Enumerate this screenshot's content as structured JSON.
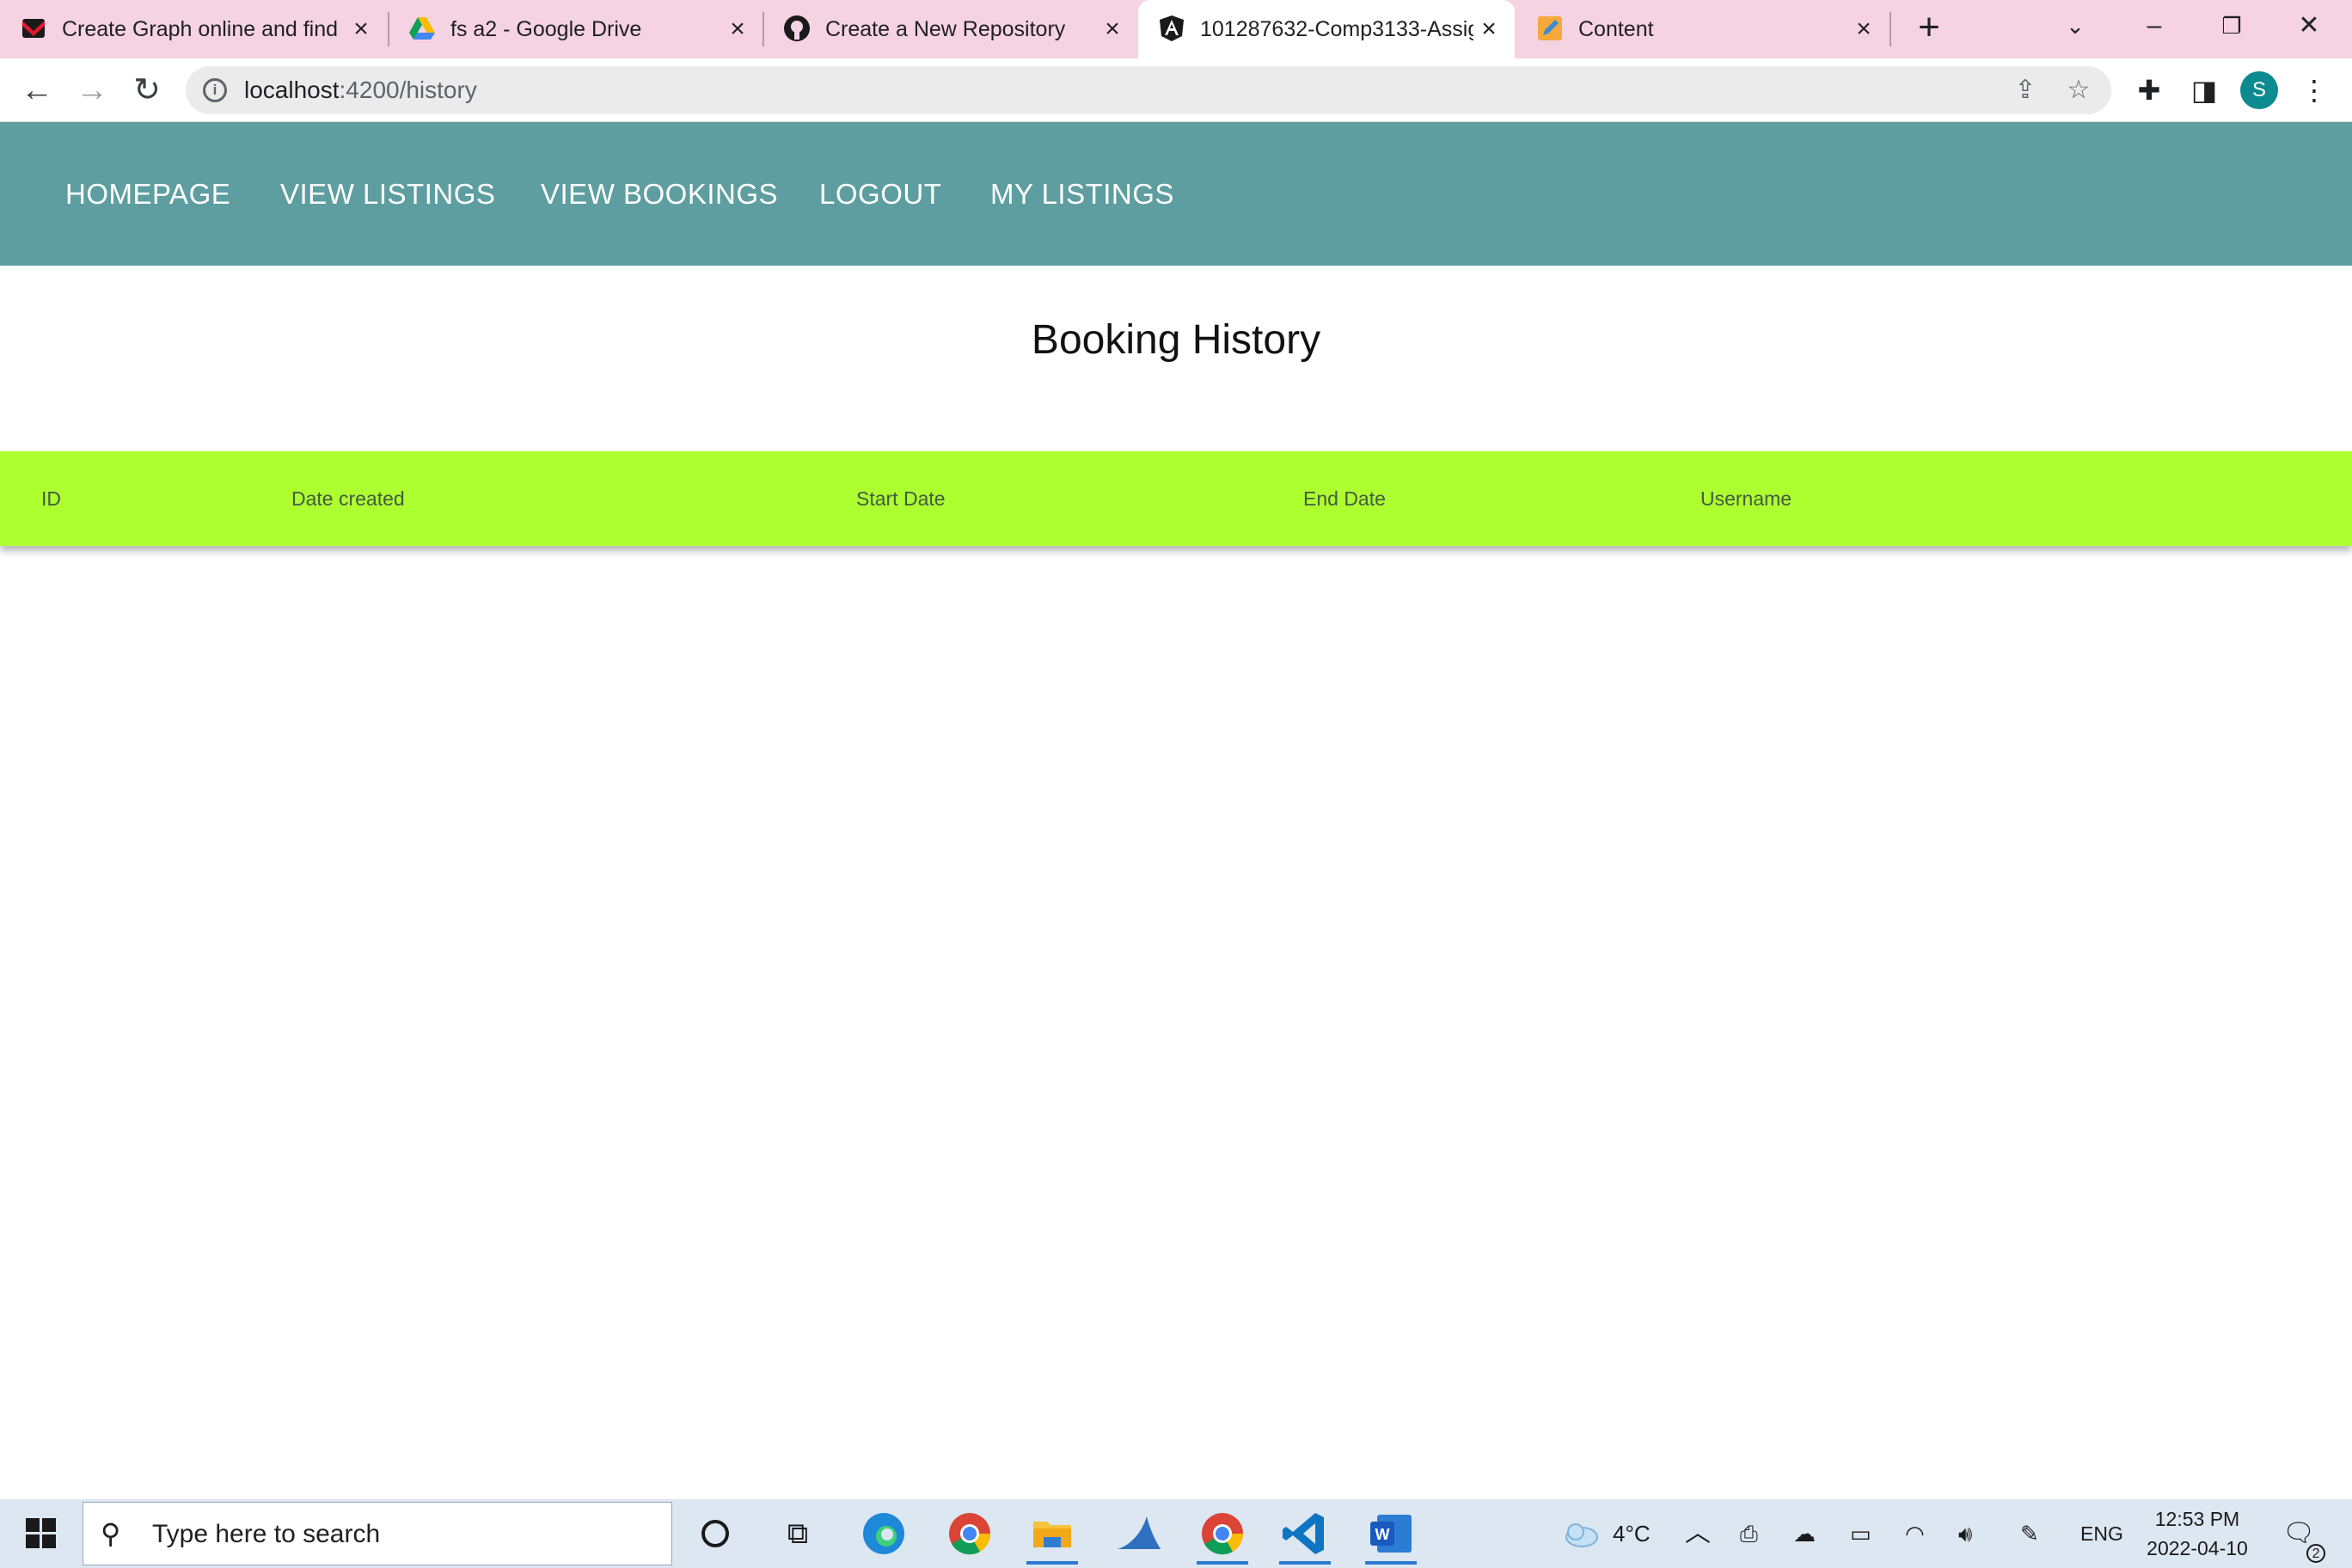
{
  "browser": {
    "tabs": [
      {
        "title": "Create Graph online and find",
        "active": false
      },
      {
        "title": "fs a2 - Google Drive",
        "active": false
      },
      {
        "title": "Create a New Repository",
        "active": false
      },
      {
        "title": "101287632-Comp3133-Assig",
        "active": true
      },
      {
        "title": "Content",
        "active": false
      }
    ],
    "address": {
      "host": "localhost",
      "rest": ":4200/history"
    },
    "profile_initial": "S"
  },
  "appnav": {
    "links": [
      "HOMEPAGE",
      "VIEW LISTINGS",
      "VIEW BOOKINGS",
      "LOGOUT",
      "MY LISTINGS"
    ],
    "background": "#5f9ea0"
  },
  "page": {
    "title": "Booking History"
  },
  "table": {
    "columns": [
      "ID",
      "Date created",
      "Start Date",
      "End Date",
      "Username"
    ],
    "header_color": "#adff2f",
    "rows": []
  },
  "taskbar": {
    "search_placeholder": "Type here to search",
    "weather": "4°C",
    "language": "ENG",
    "time": "12:53 PM",
    "date": "2022-04-10",
    "notifications": "2"
  }
}
